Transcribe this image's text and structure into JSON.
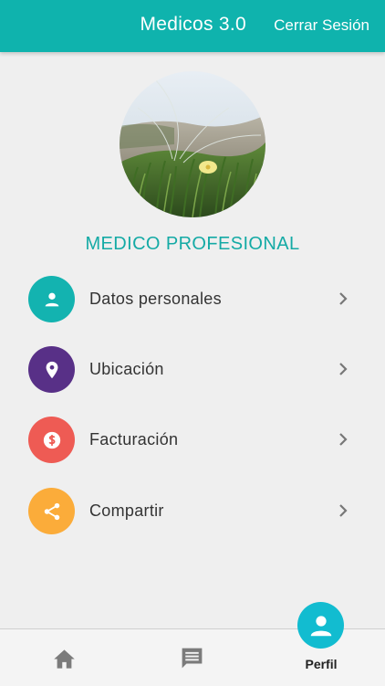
{
  "header": {
    "title": "Medicos 3.0",
    "logout_label": "Cerrar Sesión"
  },
  "profile": {
    "name": "MEDICO PROFESIONAL"
  },
  "colors": {
    "accent": "#0fb3ad",
    "datos": "#13b3b0",
    "ubicacion": "#583087",
    "facturacion": "#ee5b54",
    "compartir": "#fbac3a",
    "perfil": "#12bcd0"
  },
  "menu": {
    "items": [
      {
        "label": "Datos personales",
        "icon": "person-icon"
      },
      {
        "label": "Ubicación",
        "icon": "location-pin-icon"
      },
      {
        "label": "Facturación",
        "icon": "dollar-icon"
      },
      {
        "label": "Compartir",
        "icon": "share-icon"
      }
    ]
  },
  "tabs": {
    "home_icon": "home-icon",
    "messages_icon": "chat-icon",
    "perfil_label": "Perfil"
  }
}
